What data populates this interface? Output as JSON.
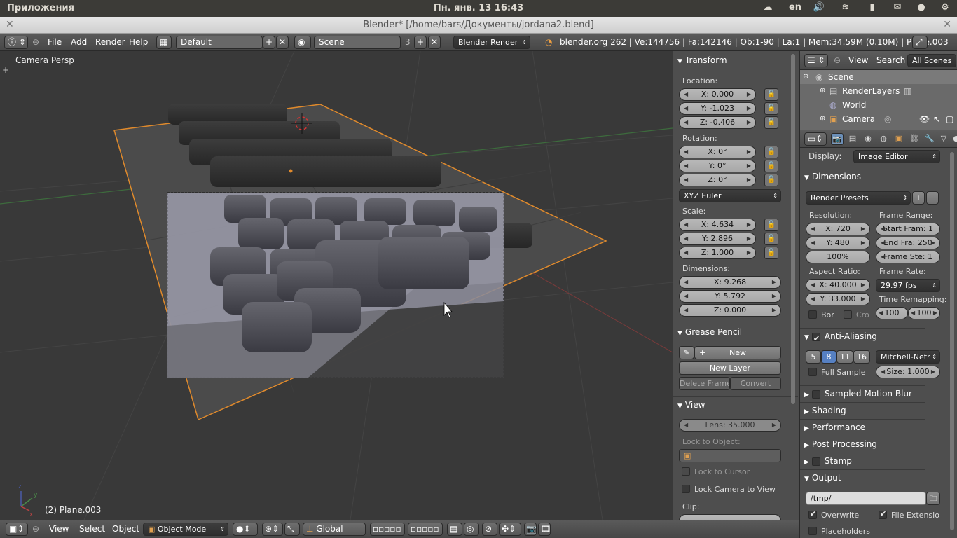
{
  "desktop": {
    "app_menu": "Приложения",
    "clock": "Пн. янв. 13 16:43",
    "keyboard_layout": "en",
    "indicators": [
      "cloud-icon",
      "volume-icon",
      "wifi-icon",
      "battery-icon",
      "chat-icon",
      "user-icon",
      "gear-icon"
    ]
  },
  "window": {
    "title": "Blender* [/home/bars/Документы/jordana2.blend]"
  },
  "info_header": {
    "menus": [
      "File",
      "Add",
      "Render",
      "Help"
    ],
    "screen_layout": "Default",
    "scene": "Scene",
    "scene_users": "3",
    "render_engine": "Blender Render",
    "stats": "blender.org 262 | Ve:144756 | Fa:142146 | Ob:1-90 | La:1 | Mem:34.59M (0.10M) | Plane.003"
  },
  "viewport": {
    "view_label": "Camera Persp",
    "object_label": "(2) Plane.003"
  },
  "n_panel": {
    "transform": {
      "title": "Transform",
      "location_label": "Location:",
      "location": [
        "X: 0.000",
        "Y: -1.023",
        "Z: -0.406"
      ],
      "rotation_label": "Rotation:",
      "rotation": [
        "X: 0°",
        "Y: 0°",
        "Z: 0°"
      ],
      "rotation_mode": "XYZ Euler",
      "scale_label": "Scale:",
      "scale": [
        "X: 4.634",
        "Y: 2.896",
        "Z: 1.000"
      ],
      "dimensions_label": "Dimensions:",
      "dimensions": [
        "X: 9.268",
        "Y: 5.792",
        "Z: 0.000"
      ]
    },
    "grease_pencil": {
      "title": "Grease Pencil",
      "new": "New",
      "new_layer": "New Layer",
      "delete_frame": "Delete Frame",
      "convert": "Convert"
    },
    "view": {
      "title": "View",
      "lens": "Lens: 35.000",
      "lock_to_object": "Lock to Object:",
      "lock_to_cursor": "Lock to Cursor",
      "lock_camera_to_view": "Lock Camera to View",
      "clip": "Clip:"
    }
  },
  "outliner": {
    "view_menu": "View",
    "search_menu": "Search",
    "filter": "All Scenes",
    "items": [
      "Scene",
      "RenderLayers",
      "World",
      "Camera"
    ]
  },
  "properties": {
    "display_label": "Display:",
    "display_value": "Image Editor",
    "dimensions": {
      "title": "Dimensions",
      "render_presets": "Render Presets",
      "resolution_label": "Resolution:",
      "res_x": "X: 720",
      "res_y": "Y: 480",
      "res_pct": "100%",
      "frame_range_label": "Frame Range:",
      "start": "Start Fram: 1",
      "end": "End Fra: 250",
      "step": "Frame Ste: 1",
      "aspect_label": "Aspect Ratio:",
      "aspect_x": "X: 40.000",
      "aspect_y": "Y: 33.000",
      "frame_rate_label": "Frame Rate:",
      "frame_rate": "29.97 fps",
      "time_remap_label": "Time Remapping:",
      "remap_old": "100",
      "remap_new": "100",
      "border": "Bor",
      "crop": "Cro"
    },
    "anti_aliasing": {
      "title": "Anti-Aliasing",
      "samples": [
        "5",
        "8",
        "11",
        "16"
      ],
      "selected_sample": "8",
      "filter": "Mitchell-Netr",
      "full_sample": "Full Sample",
      "size": "Size: 1.000"
    },
    "collapsed_panels": [
      "Sampled Motion Blur",
      "Shading",
      "Performance",
      "Post Processing",
      "Stamp"
    ],
    "output": {
      "title": "Output",
      "path": "/tmp/",
      "overwrite": "Overwrite",
      "file_extensions": "File Extensio",
      "placeholders": "Placeholders"
    }
  },
  "viewport_header": {
    "menus": [
      "View",
      "Select",
      "Object"
    ],
    "mode": "Object Mode",
    "orientation": "Global"
  }
}
